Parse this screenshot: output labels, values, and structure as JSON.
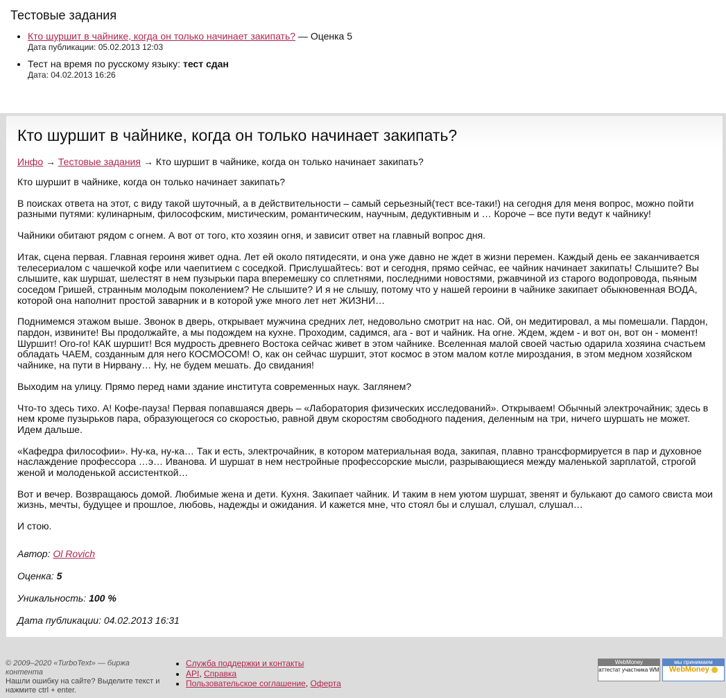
{
  "tests": {
    "heading": "Тестовые задания",
    "items": [
      {
        "link": "Кто шуршит в чайнике, когда он только начинает закипать?",
        "after": " — Оценка 5",
        "meta": "Дата публикации: 05.02.2013 12:03"
      },
      {
        "text": "Тест на время по русскому языку: ",
        "bold": "тест сдан",
        "meta": "Дата: 04.02.2013 16:26"
      }
    ]
  },
  "article": {
    "title": "Кто шуршит в чайнике, когда он только начинает закипать?",
    "breadcrumb": {
      "home": "Инфо",
      "arrow1": " → ",
      "section": "Тестовые задания",
      "arrow2": " → ",
      "current": "Кто шуршит в чайнике, когда он только начинает закипать?"
    },
    "paragraphs": [
      "Кто шуршит в чайнике, когда он только начинает закипать?",
      "В поисках ответа на этот, с виду такой шуточный, а в действительности – самый серьезный(тест все-таки!) на сегодня для меня вопрос, можно пойти разными путями: кулинарным, философским, мистическим, романтическим, научным, дедуктивным и … Короче – все пути ведут к чайнику!",
      "Чайники обитают рядом с огнем. А вот от того, кто хозяин огня, и зависит ответ на главный вопрос дня.",
      "Итак, сцена первая. Главная героиня живет одна. Лет ей около пятидесяти, и она уже давно не ждет в жизни перемен. Каждый день ее заканчивается телесериалом с чашечкой кофе или чаепитием с соседкой. Прислушайтесь: вот и сегодня, прямо сейчас, ее чайник начинает закипать! Слышите? Вы слышите, как шуршат, шелестят в нем пузырьки пара вперемешку со сплетнями, последними новостями, ржавчиной из старого водопровода, пьяным соседом Гришей, странным молодым поколением? Не слышите? И я не слышу, потому что у нашей героини в чайнике закипает обыкновенная ВОДА, которой она наполнит простой заварник и в которой уже много лет нет ЖИЗНИ…",
      "Поднимемся этажом выше. Звонок в дверь, открывает мужчина средних лет, недовольно смотрит на нас. Ой, он медитировал, а мы помешали. Пардон, пардон, извините! Вы продолжайте, а мы подождем на кухне. Проходим, садимся, ага - вот и чайник. На огне. Ждем, ждем - и вот он, вот он - момент! Шуршит! Ого-го! КАК шуршит! Вся мудрость древнего Востока сейчас живет в этом чайнике. Вселенная малой своей частью одарила хозяина счастьем обладать ЧАЕМ, созданным для него КОСМОСОМ! О, как он сейчас шуршит, этот космос в этом малом котле мироздания, в этом медном хозяйском чайнике, на пути в Нирвану… Ну, не будем мешать. До свидания!",
      "Выходим на улицу. Прямо перед нами здание института современных наук. Заглянем?",
      "Что-то здесь тихо. А! Кофе-пауза! Первая попавшаяся дверь – «Лаборатория физических исследований». Открываем! Обычный электрочайник; здесь в нем кроме пузырьков пара, образующегося со скоростью, равной двум скоростям свободного падения, деленным на три, ничего шуршать не может. Идем дальше.",
      "«Кафедра философии». Ну-ка, ну-ка… Так и есть, электрочайник, в котором материальная вода, закипая, плавно трансформируется в пар и духовное наслаждение профессора …э… Иванова. И шуршат в нем нестройные профессорские мысли, разрывающиеся между маленькой зарплатой, строгой женой и молоденькой ассистенткой…",
      "Вот и вечер. Возвращаюсь домой. Любимые жена и дети. Кухня. Закипает чайник. И таким в нем уютом шуршат, звенят и булькают до самого свиста мои жизнь, мечты, будущее и прошлое, любовь, надежды и ожидания. И кажется мне, что стоял бы и слушал, слушал, слушал…",
      "И стою."
    ],
    "author_label": "Автор: ",
    "author": "Ol Rovich",
    "score_label": "Оценка: ",
    "score": "5",
    "unique_label": "Уникальность: ",
    "unique": "100 %",
    "date": "Дата публикации: 04.02.2013 16:31"
  },
  "footer": {
    "copyright": "© 2009–2020 «TurboText» — биржа контента",
    "hint": "Нашли ошибку на сайте? Выделите текст и нажмите ctrl + enter.",
    "links": [
      {
        "a": "Служба поддержки и контакты"
      },
      {
        "a": "API",
        "sep": ", ",
        "b": "Справка"
      },
      {
        "a": "Пользовательское соглашение",
        "sep": ", ",
        "b": "Оферта"
      }
    ],
    "badge1_top": "WebMoney",
    "badge1_bottom": "аттестат участника WM",
    "badge2_top": "мы принимаем",
    "badge2_bottom": "WebMoney"
  }
}
